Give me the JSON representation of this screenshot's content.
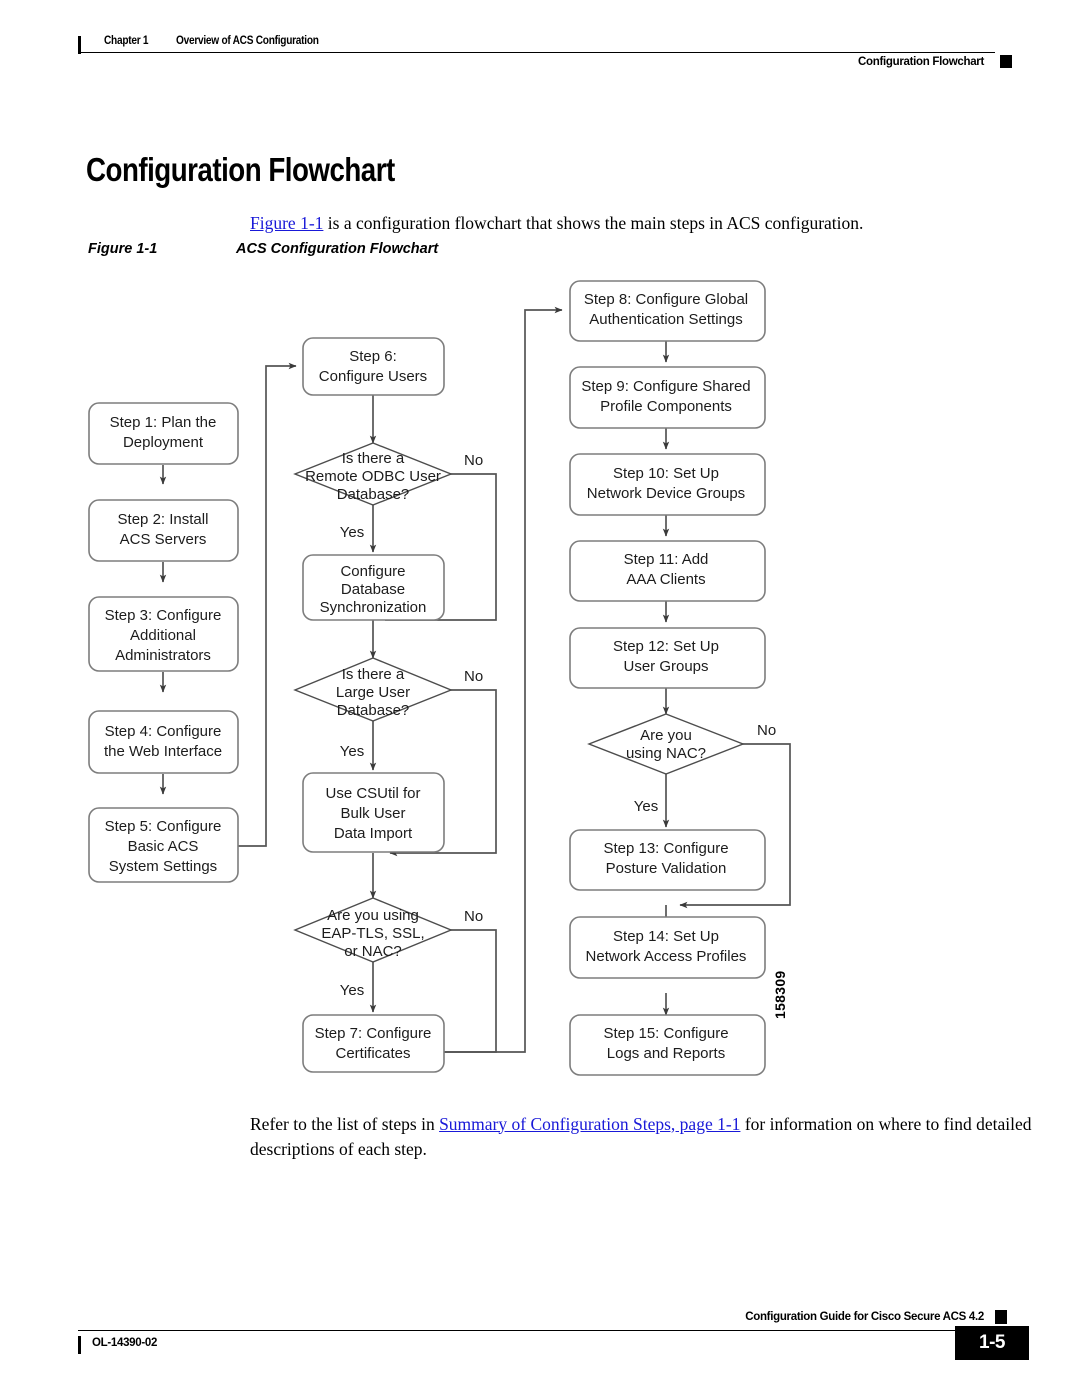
{
  "header": {
    "chapter_label": "Chapter 1",
    "chapter_title": "Overview of ACS Configuration",
    "section_title": "Configuration Flowchart"
  },
  "section_heading": "Configuration Flowchart",
  "intro": {
    "link": "Figure 1-1",
    "rest": " is a configuration flowchart that shows the main steps in ACS configuration."
  },
  "figure": {
    "number": "Figure 1-1",
    "title": "ACS Configuration Flowchart",
    "figure_id": "158309"
  },
  "closing": {
    "before": "Refer to the list of steps in ",
    "link": "Summary of Configuration Steps, page 1-1",
    "after": " for information on where to find detailed descriptions of each step."
  },
  "footer": {
    "doc_id": "OL-14390-02",
    "guide_title": "Configuration Guide for Cisco Secure ACS 4.2",
    "page_number": "1-5"
  },
  "colors": {
    "link": "#1919d8",
    "node_border": "#7d7d7d",
    "diamond_border": "#4d4d4d",
    "connector": "#555555",
    "text": "#1c1c1c"
  },
  "chart_data": {
    "type": "flowchart",
    "title": "ACS Configuration Flowchart",
    "columns": [
      "left",
      "middle",
      "right"
    ],
    "nodes": [
      {
        "id": "s1",
        "shape": "process",
        "column": "left",
        "lines": [
          "Step 1: Plan the",
          "Deployment"
        ]
      },
      {
        "id": "s2",
        "shape": "process",
        "column": "left",
        "lines": [
          "Step 2: Install",
          "ACS Servers"
        ]
      },
      {
        "id": "s3",
        "shape": "process",
        "column": "left",
        "lines": [
          "Step 3: Configure",
          "Additional",
          "Administrators"
        ]
      },
      {
        "id": "s4",
        "shape": "process",
        "column": "left",
        "lines": [
          "Step 4: Configure",
          "the Web Interface"
        ]
      },
      {
        "id": "s5",
        "shape": "process",
        "column": "left",
        "lines": [
          "Step 5: Configure",
          "Basic ACS",
          "System Settings"
        ]
      },
      {
        "id": "s6",
        "shape": "process",
        "column": "middle",
        "lines": [
          "Step 6:",
          "Configure Users"
        ]
      },
      {
        "id": "d1",
        "shape": "decision",
        "column": "middle",
        "lines": [
          "Is there a",
          "Remote ODBC User",
          "Database?"
        ]
      },
      {
        "id": "m1",
        "shape": "process",
        "column": "middle",
        "lines": [
          "Configure",
          "Database",
          "Synchronization"
        ]
      },
      {
        "id": "d2",
        "shape": "decision",
        "column": "middle",
        "lines": [
          "Is there a",
          "Large User",
          "Database?"
        ]
      },
      {
        "id": "m2",
        "shape": "process",
        "column": "middle",
        "lines": [
          "Use CSUtil for",
          "Bulk User",
          "Data Import"
        ]
      },
      {
        "id": "d3",
        "shape": "decision",
        "column": "middle",
        "lines": [
          "Are you using",
          "EAP-TLS, SSL,",
          "or NAC?"
        ]
      },
      {
        "id": "s7",
        "shape": "process",
        "column": "middle",
        "lines": [
          "Step 7: Configure",
          "Certificates"
        ]
      },
      {
        "id": "s8",
        "shape": "process",
        "column": "right",
        "lines": [
          "Step 8: Configure Global",
          "Authentication Settings"
        ]
      },
      {
        "id": "s9",
        "shape": "process",
        "column": "right",
        "lines": [
          "Step 9: Configure Shared",
          "Profile Components"
        ]
      },
      {
        "id": "s10",
        "shape": "process",
        "column": "right",
        "lines": [
          "Step 10: Set Up",
          "Network Device Groups"
        ]
      },
      {
        "id": "s11",
        "shape": "process",
        "column": "right",
        "lines": [
          "Step 11: Add",
          "AAA Clients"
        ]
      },
      {
        "id": "s12",
        "shape": "process",
        "column": "right",
        "lines": [
          "Step 12: Set Up",
          "User Groups"
        ]
      },
      {
        "id": "d4",
        "shape": "decision",
        "column": "right",
        "lines": [
          "Are you",
          "using NAC?"
        ]
      },
      {
        "id": "s13",
        "shape": "process",
        "column": "right",
        "lines": [
          "Step 13: Configure",
          "Posture Validation"
        ]
      },
      {
        "id": "s14",
        "shape": "process",
        "column": "right",
        "lines": [
          "Step 14: Set Up",
          "Network Access Profiles"
        ]
      },
      {
        "id": "s15",
        "shape": "process",
        "column": "right",
        "lines": [
          "Step 15: Configure",
          "Logs and  Reports"
        ]
      }
    ],
    "edges": [
      {
        "from": "s1",
        "to": "s2",
        "label": ""
      },
      {
        "from": "s2",
        "to": "s3",
        "label": ""
      },
      {
        "from": "s3",
        "to": "s4",
        "label": ""
      },
      {
        "from": "s4",
        "to": "s5",
        "label": ""
      },
      {
        "from": "s5",
        "to": "s6",
        "label": ""
      },
      {
        "from": "s6",
        "to": "d1",
        "label": ""
      },
      {
        "from": "d1",
        "to": "m1",
        "label": "Yes"
      },
      {
        "from": "d1",
        "to": "d2",
        "label": "No"
      },
      {
        "from": "m1",
        "to": "d2",
        "label": ""
      },
      {
        "from": "d2",
        "to": "m2",
        "label": "Yes"
      },
      {
        "from": "d2",
        "to": "d3",
        "label": "No"
      },
      {
        "from": "m2",
        "to": "d3",
        "label": ""
      },
      {
        "from": "d3",
        "to": "s7",
        "label": "Yes"
      },
      {
        "from": "d3",
        "to": "s8",
        "label": "No"
      },
      {
        "from": "s7",
        "to": "s8",
        "label": ""
      },
      {
        "from": "s8",
        "to": "s9",
        "label": ""
      },
      {
        "from": "s9",
        "to": "s10",
        "label": ""
      },
      {
        "from": "s10",
        "to": "s11",
        "label": ""
      },
      {
        "from": "s11",
        "to": "s12",
        "label": ""
      },
      {
        "from": "s12",
        "to": "d4",
        "label": ""
      },
      {
        "from": "d4",
        "to": "s13",
        "label": "Yes"
      },
      {
        "from": "d4",
        "to": "s14",
        "label": "No"
      },
      {
        "from": "s13",
        "to": "s14",
        "label": ""
      },
      {
        "from": "s14",
        "to": "s15",
        "label": ""
      }
    ],
    "branch_labels": [
      "Yes",
      "No"
    ]
  }
}
